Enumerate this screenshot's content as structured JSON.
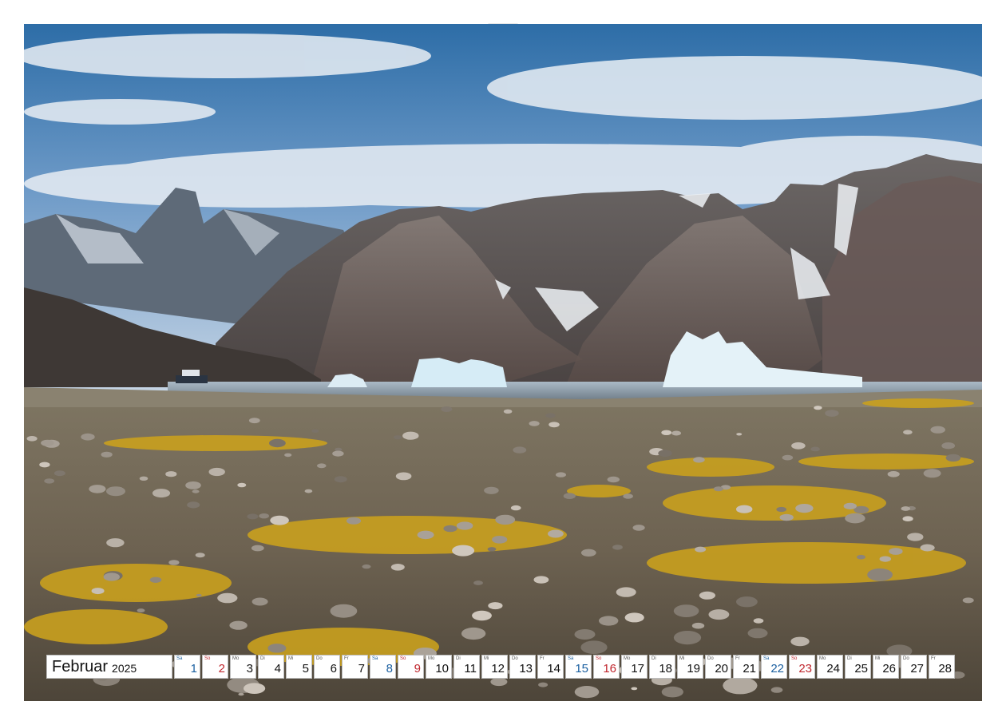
{
  "calendar": {
    "month": "Februar",
    "year": "2025",
    "days": [
      {
        "wd": "Sa",
        "d": "1",
        "type": "sat"
      },
      {
        "wd": "So",
        "d": "2",
        "type": "sun"
      },
      {
        "wd": "Mo",
        "d": "3",
        "type": "wk"
      },
      {
        "wd": "Di",
        "d": "4",
        "type": "wk"
      },
      {
        "wd": "Mi",
        "d": "5",
        "type": "wk"
      },
      {
        "wd": "Do",
        "d": "6",
        "type": "wk"
      },
      {
        "wd": "Fr",
        "d": "7",
        "type": "wk"
      },
      {
        "wd": "Sa",
        "d": "8",
        "type": "sat"
      },
      {
        "wd": "So",
        "d": "9",
        "type": "sun"
      },
      {
        "wd": "Mo",
        "d": "10",
        "type": "wk"
      },
      {
        "wd": "Di",
        "d": "11",
        "type": "wk"
      },
      {
        "wd": "Mi",
        "d": "12",
        "type": "wk"
      },
      {
        "wd": "Do",
        "d": "13",
        "type": "wk"
      },
      {
        "wd": "Fr",
        "d": "14",
        "type": "wk"
      },
      {
        "wd": "Sa",
        "d": "15",
        "type": "sat"
      },
      {
        "wd": "So",
        "d": "16",
        "type": "sun"
      },
      {
        "wd": "Mo",
        "d": "17",
        "type": "wk"
      },
      {
        "wd": "Di",
        "d": "18",
        "type": "wk"
      },
      {
        "wd": "Mi",
        "d": "19",
        "type": "wk"
      },
      {
        "wd": "Do",
        "d": "20",
        "type": "wk"
      },
      {
        "wd": "Fr",
        "d": "21",
        "type": "wk"
      },
      {
        "wd": "Sa",
        "d": "22",
        "type": "sat"
      },
      {
        "wd": "So",
        "d": "23",
        "type": "sun"
      },
      {
        "wd": "Mo",
        "d": "24",
        "type": "wk"
      },
      {
        "wd": "Di",
        "d": "25",
        "type": "wk"
      },
      {
        "wd": "Mi",
        "d": "26",
        "type": "wk"
      },
      {
        "wd": "Do",
        "d": "27",
        "type": "wk"
      },
      {
        "wd": "Fr",
        "d": "28",
        "type": "wk"
      }
    ]
  },
  "colors": {
    "saturday": "#1a5fa0",
    "sunday": "#c0262d",
    "sky_top": "#2f6fa8",
    "tundra_yellow": "#c9a01e"
  },
  "photo": {
    "icon": "landscape-photo"
  }
}
